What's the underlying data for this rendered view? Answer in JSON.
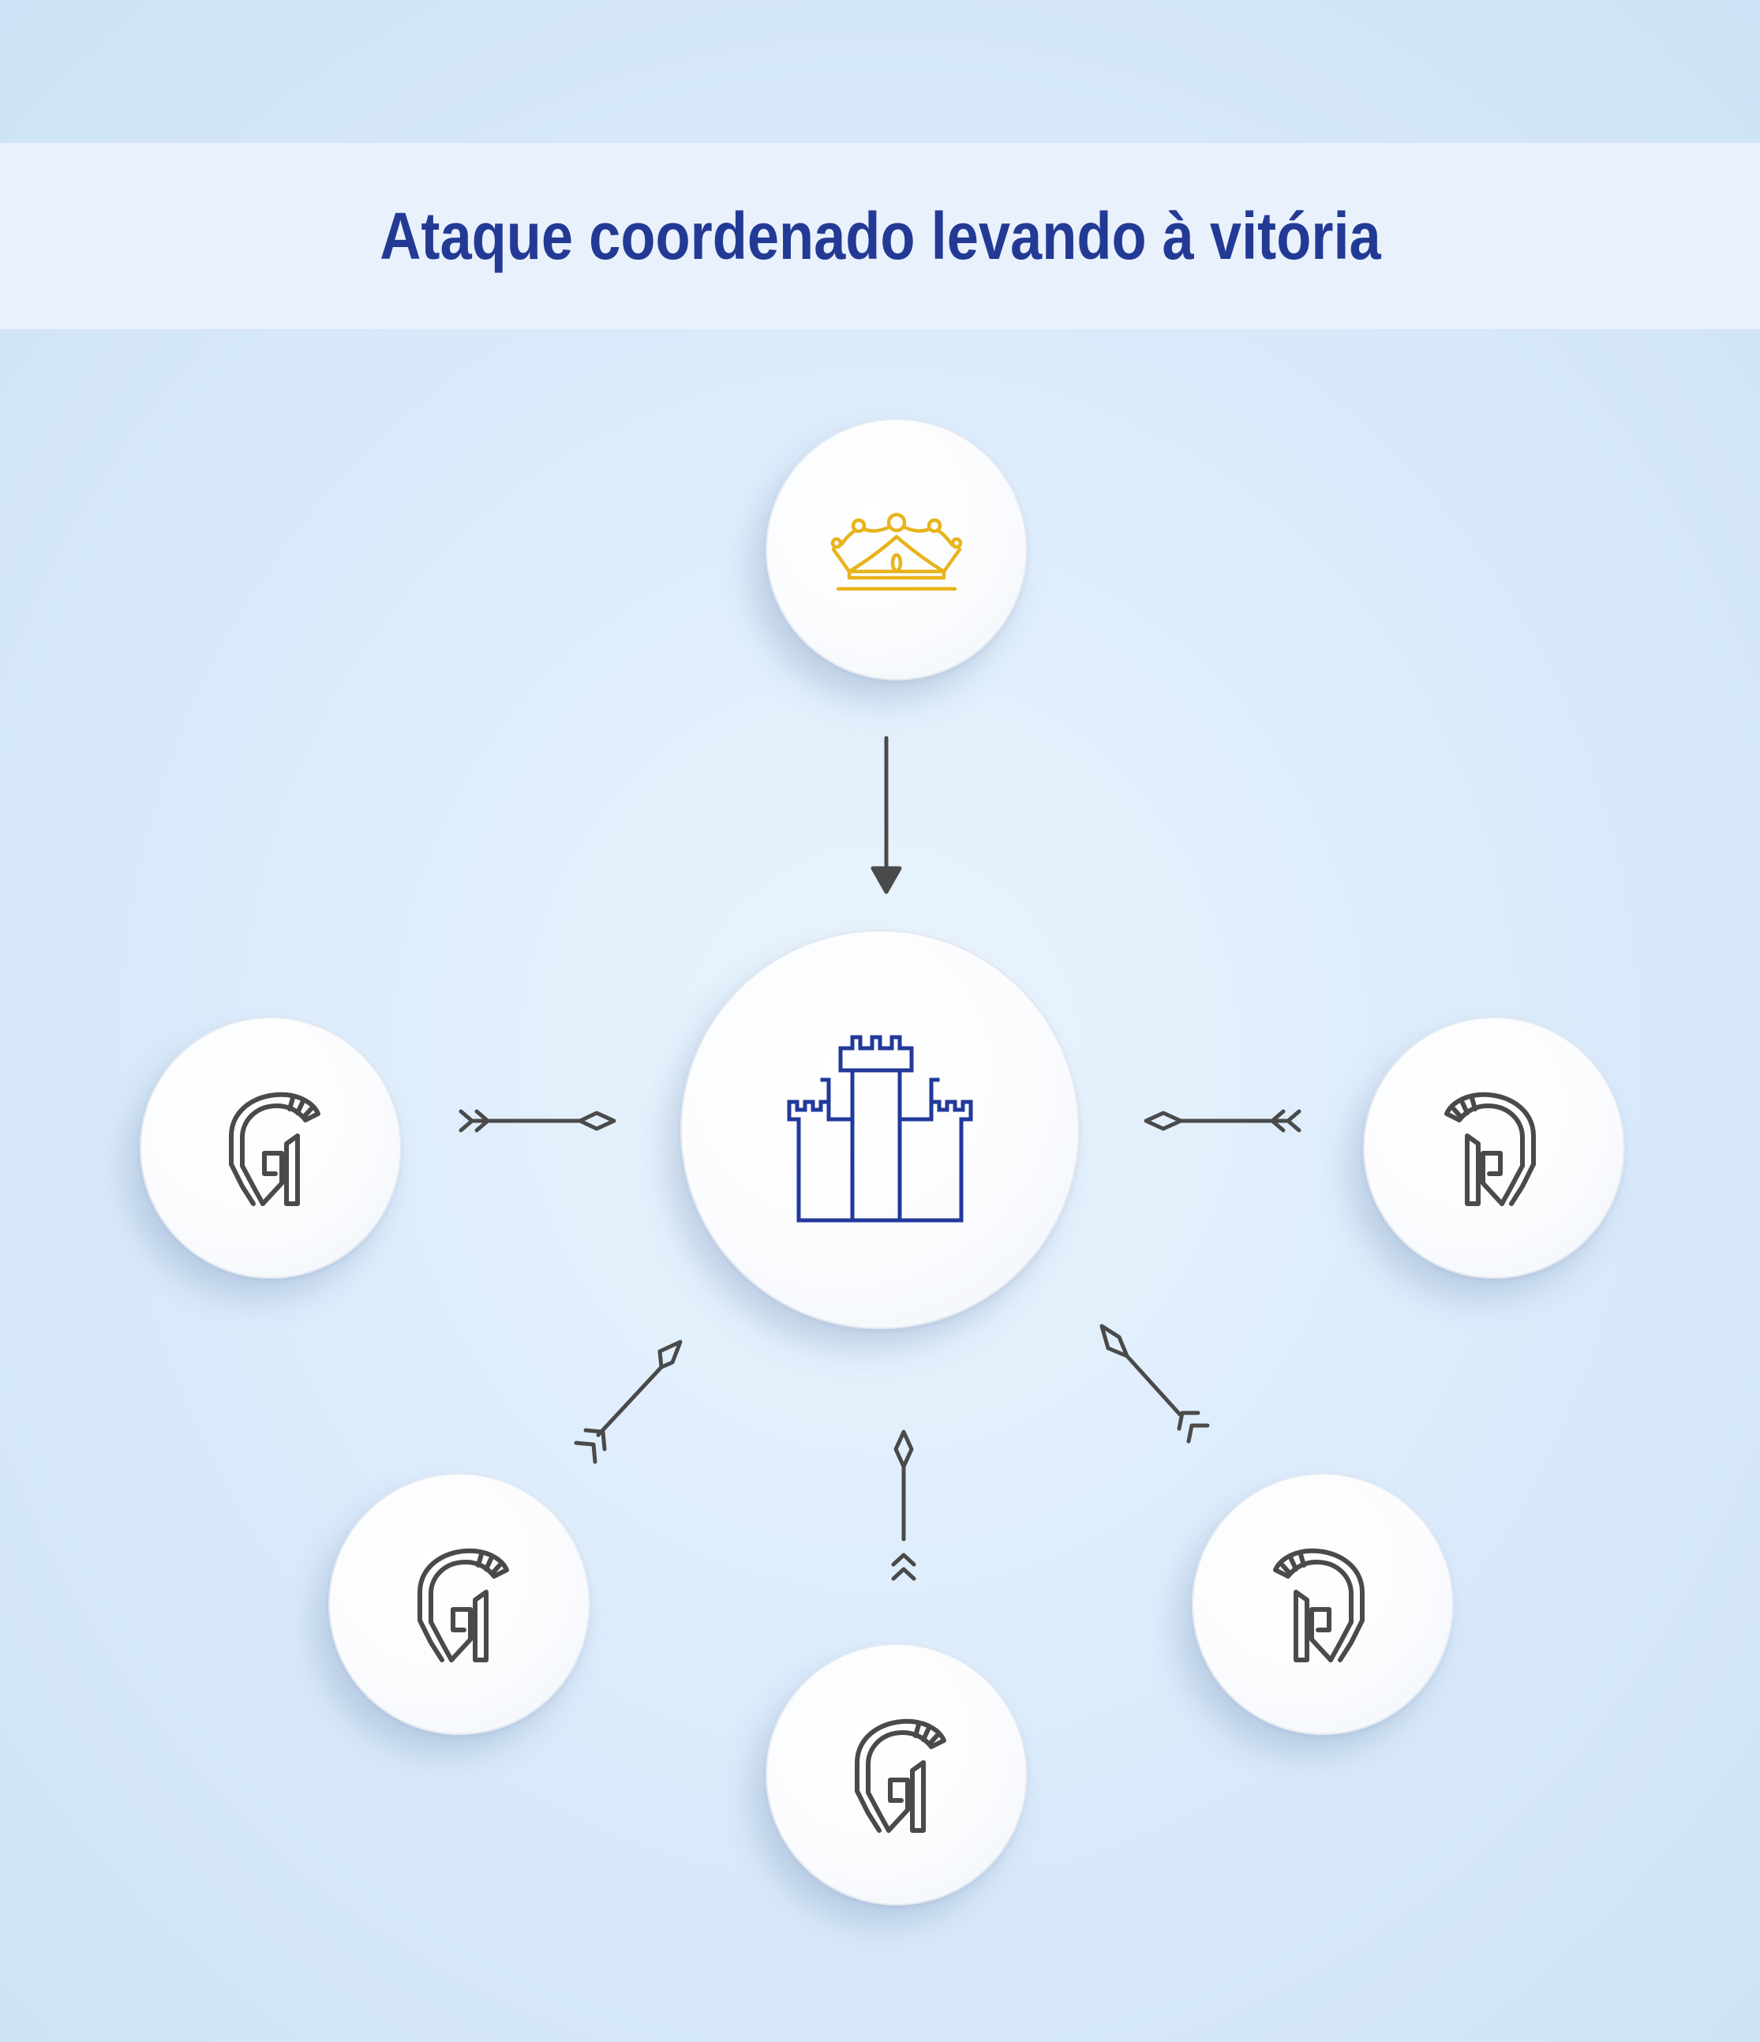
{
  "title": "Ataque coordenado levando à vitória",
  "colors": {
    "title": "#233a95",
    "crown": "#e8b41c",
    "castle": "#22399a",
    "helmet": "#4a4a4a",
    "arrow": "#4a4a4a"
  },
  "nodes": [
    {
      "id": "crown",
      "icon": "crown-icon"
    },
    {
      "id": "castle",
      "icon": "castle-icon"
    },
    {
      "id": "warrior-left",
      "icon": "helmet-icon"
    },
    {
      "id": "warrior-right",
      "icon": "helmet-icon"
    },
    {
      "id": "warrior-bottom-left",
      "icon": "helmet-icon"
    },
    {
      "id": "warrior-bottom",
      "icon": "helmet-icon"
    },
    {
      "id": "warrior-bottom-right",
      "icon": "helmet-icon"
    }
  ],
  "edges": [
    {
      "from": "crown",
      "to": "castle",
      "style": "arrow"
    },
    {
      "from": "warrior-left",
      "to": "castle",
      "style": "spear"
    },
    {
      "from": "warrior-right",
      "to": "castle",
      "style": "spear"
    },
    {
      "from": "warrior-bottom-left",
      "to": "castle",
      "style": "spear"
    },
    {
      "from": "warrior-bottom",
      "to": "castle",
      "style": "spear"
    },
    {
      "from": "warrior-bottom-right",
      "to": "castle",
      "style": "spear"
    }
  ]
}
